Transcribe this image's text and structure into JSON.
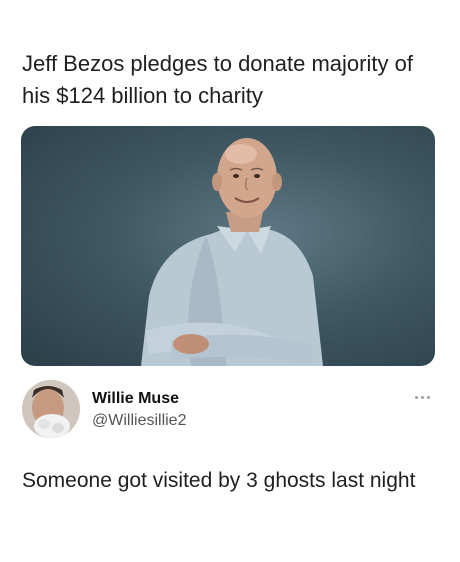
{
  "post": {
    "headline": "Jeff Bezos pledges to donate majority of his $124 billion to charity",
    "image_subject": "portrait-photo"
  },
  "tweet": {
    "author_name": "Willie Muse",
    "author_handle": "@Williesillie2",
    "text": "Someone got visited by 3 ghosts last night",
    "menu_icon": "more-horizontal-icon"
  },
  "colors": {
    "photo_background": "#3f5864",
    "text": "#1f1f1f",
    "handle": "#555555",
    "menu_dots": "#9aa0a6"
  }
}
